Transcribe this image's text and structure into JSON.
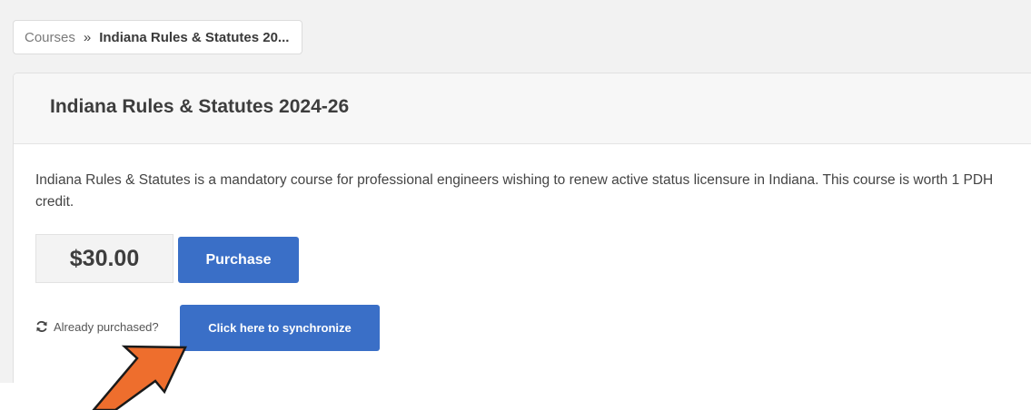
{
  "breadcrumb": {
    "root": "Courses",
    "separator": "»",
    "current": "Indiana Rules & Statutes 20..."
  },
  "course": {
    "title": "Indiana Rules & Statutes 2024-26",
    "description": "Indiana Rules & Statutes is a mandatory course for professional engineers wishing to renew active status licensure in Indiana. This course is worth 1 PDH credit.",
    "price": "$30.00",
    "purchase_label": "Purchase"
  },
  "sync": {
    "icon": "refresh-icon",
    "prompt": "Already purchased?",
    "button_label": "Click here to synchronize"
  },
  "annotation": {
    "icon": "pointer-arrow",
    "color": "#ee6e2d"
  },
  "colors": {
    "accent": "#3a6fc7",
    "page_background": "#f2f2f2"
  }
}
